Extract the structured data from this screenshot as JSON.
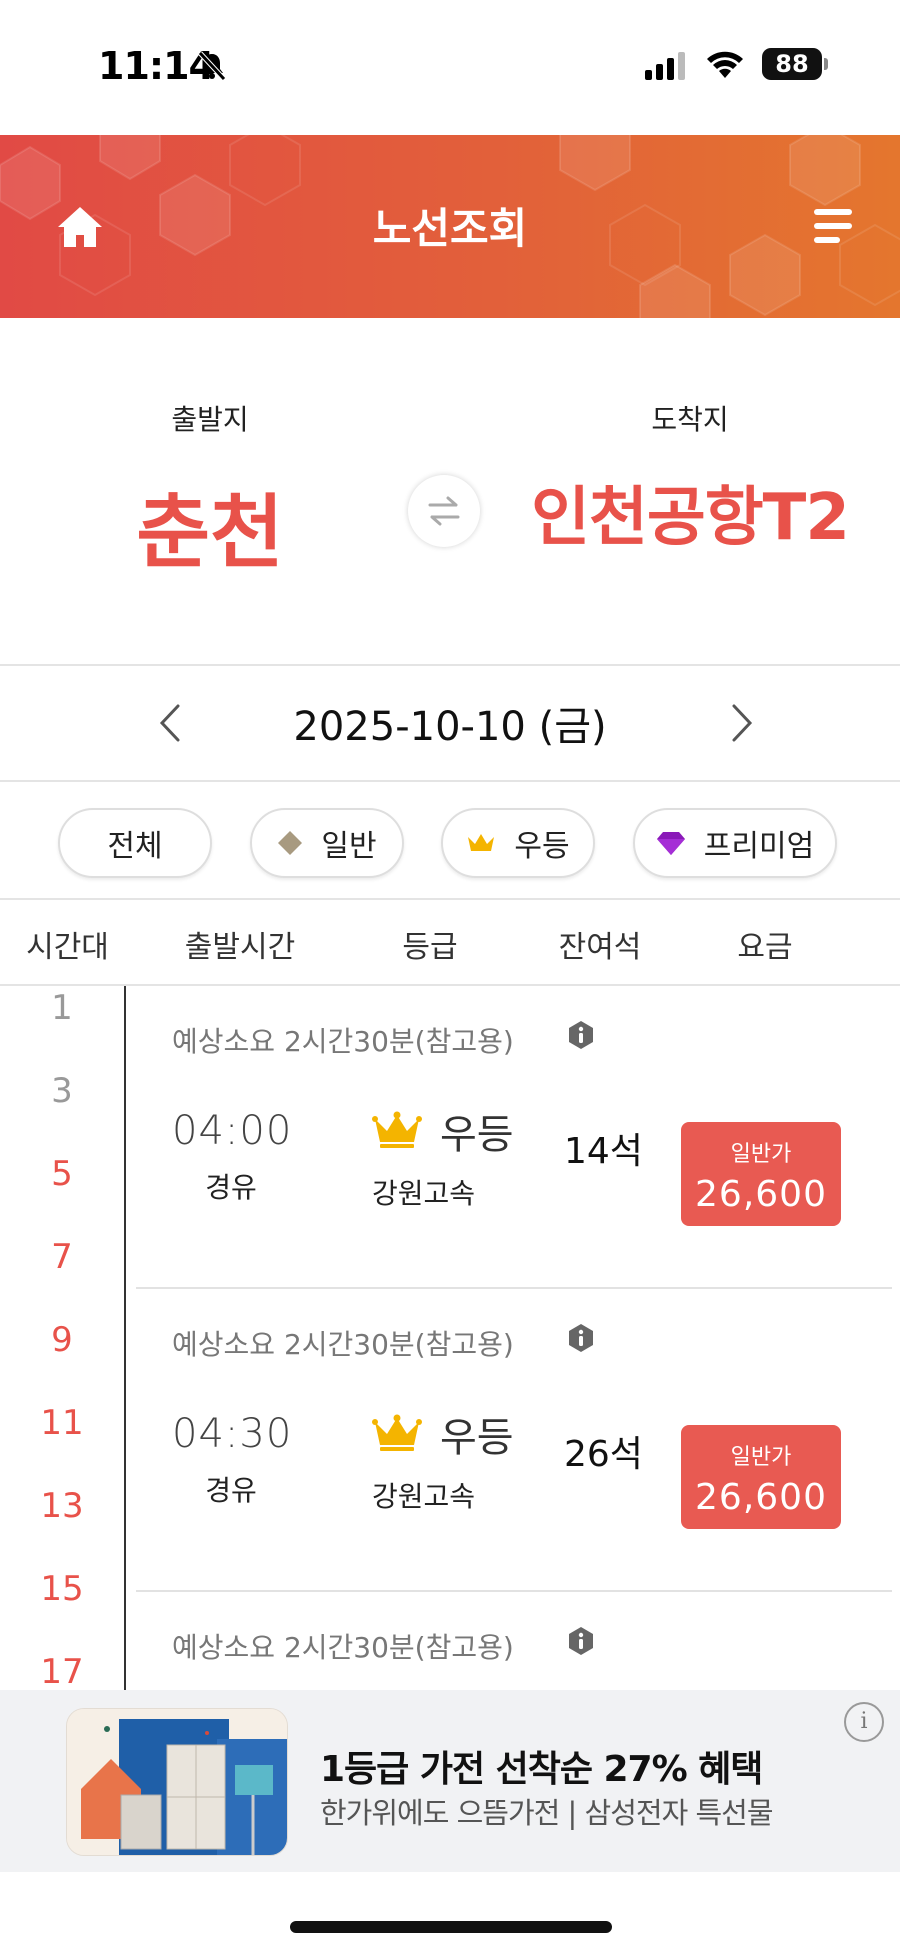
{
  "status_bar": {
    "time": "11:14",
    "battery": "88"
  },
  "header": {
    "title": "노선조회"
  },
  "route": {
    "departure_label": "출발지",
    "departure_city": "춘천",
    "arrival_label": "도착지",
    "arrival_city": "인천공항T2"
  },
  "date": {
    "value": "2025-10-10 (금)"
  },
  "filters": [
    {
      "label": "전체"
    },
    {
      "label": "일반"
    },
    {
      "label": "우등"
    },
    {
      "label": "프리미엄"
    }
  ],
  "table_header": {
    "time_slot": "시간대",
    "departure_time": "출발시간",
    "grade": "등급",
    "remaining_seats": "잔여석",
    "fare": "요금"
  },
  "hours": [
    "1",
    "3",
    "5",
    "7",
    "9",
    "11",
    "13",
    "15",
    "17"
  ],
  "trips": [
    {
      "estimate": "예상소요 2시간30분(참고용)",
      "time": "04:00",
      "route_type": "경유",
      "grade": "우등",
      "company": "강원고속",
      "seats": "14석",
      "fare_type": "일반가",
      "fare": "26,600"
    },
    {
      "estimate": "예상소요 2시간30분(참고용)",
      "time": "04:30",
      "route_type": "경유",
      "grade": "우등",
      "company": "강원고속",
      "seats": "26석",
      "fare_type": "일반가",
      "fare": "26,600"
    },
    {
      "estimate": "예상소요 2시간30분(참고용)"
    }
  ],
  "ad": {
    "title": "1등급 가전 선착순 27% 혜택",
    "subtitle": "한가위에도 으뜸가전 | 삼성전자 특선물"
  },
  "colors": {
    "accent": "#e8524a",
    "header_start": "#e14a45",
    "header_end": "#e4762e",
    "crown": "#f4b400",
    "premium": "#8a19b8",
    "normal": "#a89a80"
  },
  "icons": {
    "home": "home-icon",
    "menu": "menu-icon",
    "swap": "swap-icon",
    "info": "info-icon",
    "crown": "crown-icon",
    "diamond": "diamond-icon",
    "gem": "gem-icon"
  }
}
